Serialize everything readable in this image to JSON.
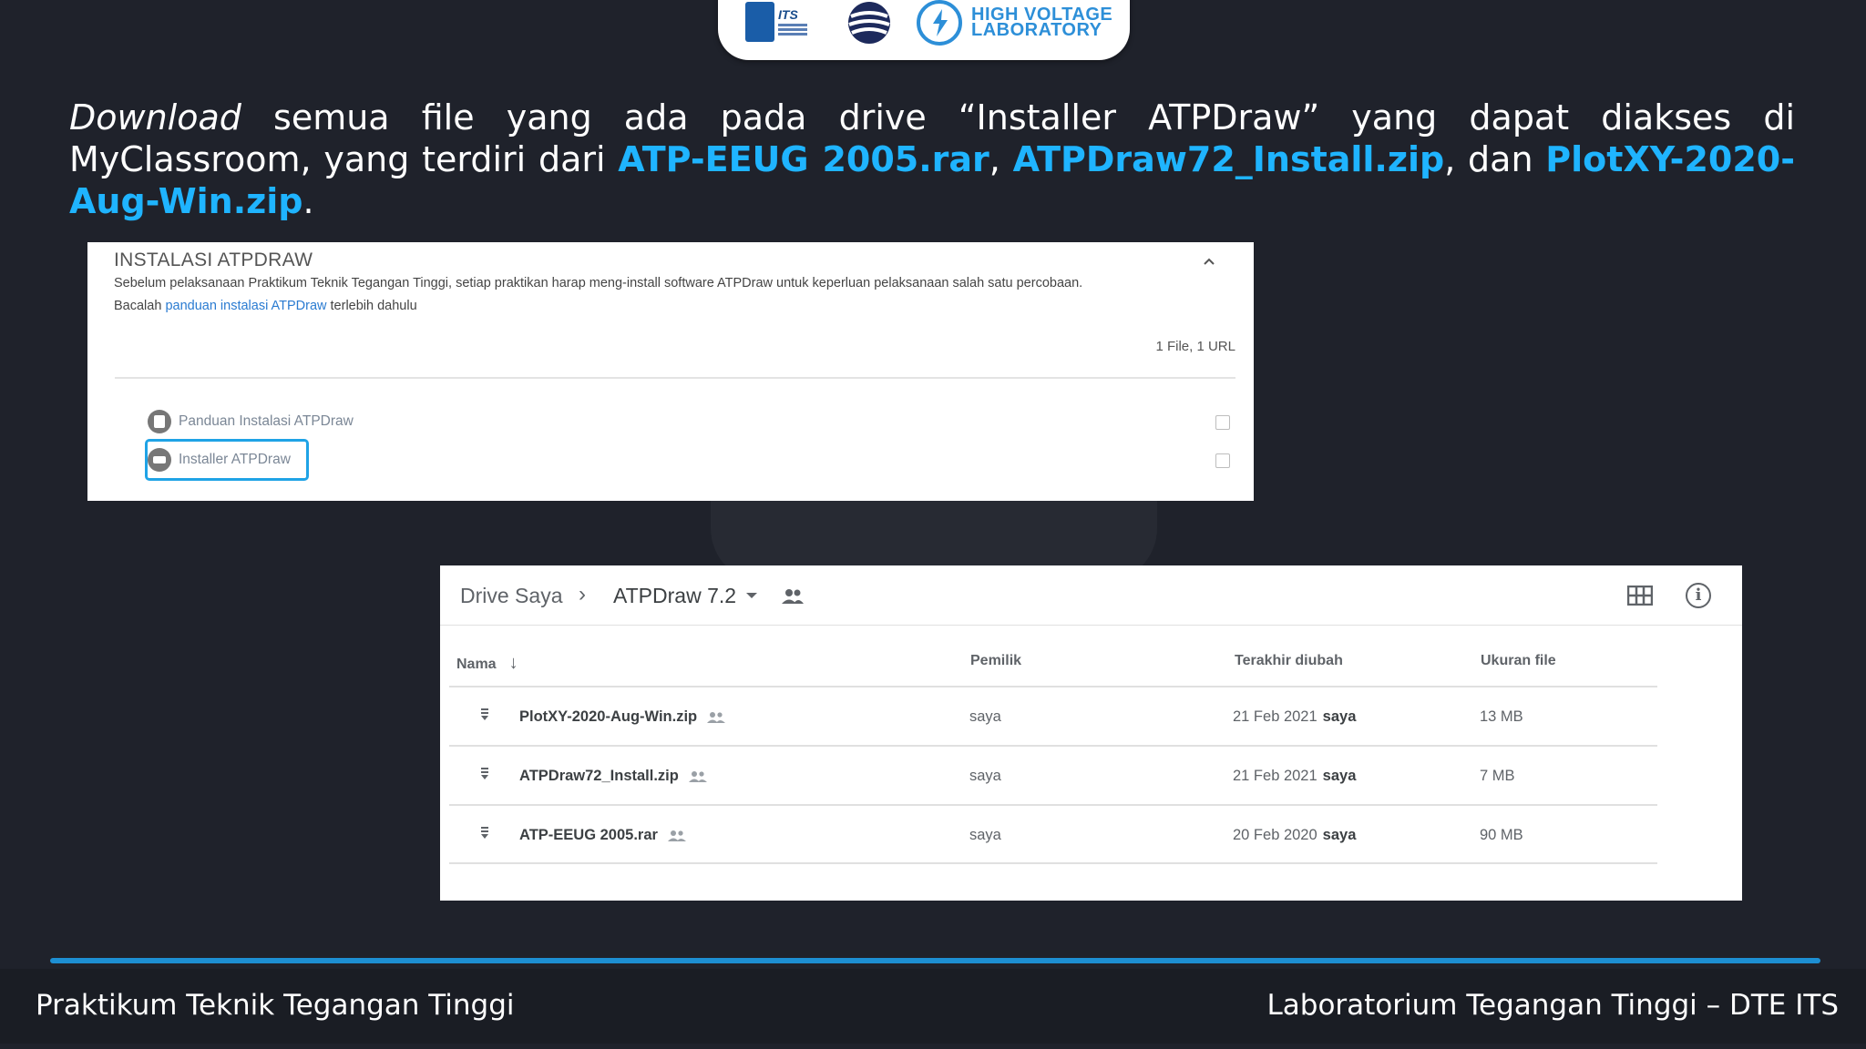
{
  "header": {
    "logos": {
      "its_logo_text": "ITS",
      "hv_logo_line1": "HIGH VOLTAGE",
      "hv_logo_line2": "LABORATORY"
    }
  },
  "intro": {
    "italic_word": "Download",
    "text_part1": " semua file yang ada pada drive “Installer ATPDraw” yang dapat diakses di MyClassroom, yang terdiri dari ",
    "file1": "ATP-EEUG 2005.rar",
    "sep1": ", ",
    "file2": "ATPDraw72_Install.zip",
    "sep2": ", dan ",
    "file3": "PlotXY-2020-Aug-Win.zip",
    "end": "."
  },
  "classroom": {
    "title": "INSTALASI ATPDRAW",
    "description1": "Sebelum pelaksanaan Praktikum Teknik Tegangan Tinggi, setiap praktikan harap meng-install software ATPDraw untuk keperluan pelaksanaan salah satu percobaan.",
    "description2_prefix": "Bacalah ",
    "description2_link": "panduan instalasi ATPDraw",
    "description2_suffix": " terlebih dahulu",
    "count": "1 File, 1 URL",
    "items": [
      {
        "label": "Panduan Instalasi ATPDraw",
        "icon": "file-icon"
      },
      {
        "label": "Installer ATPDraw",
        "icon": "link-icon"
      }
    ]
  },
  "drive": {
    "breadcrumb_root": "Drive Saya",
    "breadcrumb_separator": "›",
    "breadcrumb_folder": "ATPDraw 7.2",
    "columns": {
      "name": "Nama",
      "owner": "Pemilik",
      "modified": "Terakhir diubah",
      "size": "Ukuran file"
    },
    "sort_arrow": "↓",
    "rows": [
      {
        "name": "PlotXY-2020-Aug-Win.zip",
        "owner": "saya",
        "date": "21 Feb 2021",
        "modified_by": "saya",
        "size": "13 MB"
      },
      {
        "name": "ATPDraw72_Install.zip",
        "owner": "saya",
        "date": "21 Feb 2021",
        "modified_by": "saya",
        "size": "7 MB"
      },
      {
        "name": "ATP-EEUG 2005.rar",
        "owner": "saya",
        "date": "20 Feb 2020",
        "modified_by": "saya",
        "size": "90 MB"
      }
    ]
  },
  "footer": {
    "left": "Praktikum Teknik Tegangan Tinggi",
    "right": "Laboratorium Tegangan Tinggi – DTE ITS"
  },
  "colors": {
    "background": "#1f222b",
    "accent": "#1fb4ff",
    "footer_line": "#1d8fd3",
    "highlight_border": "#1fa3e6"
  }
}
